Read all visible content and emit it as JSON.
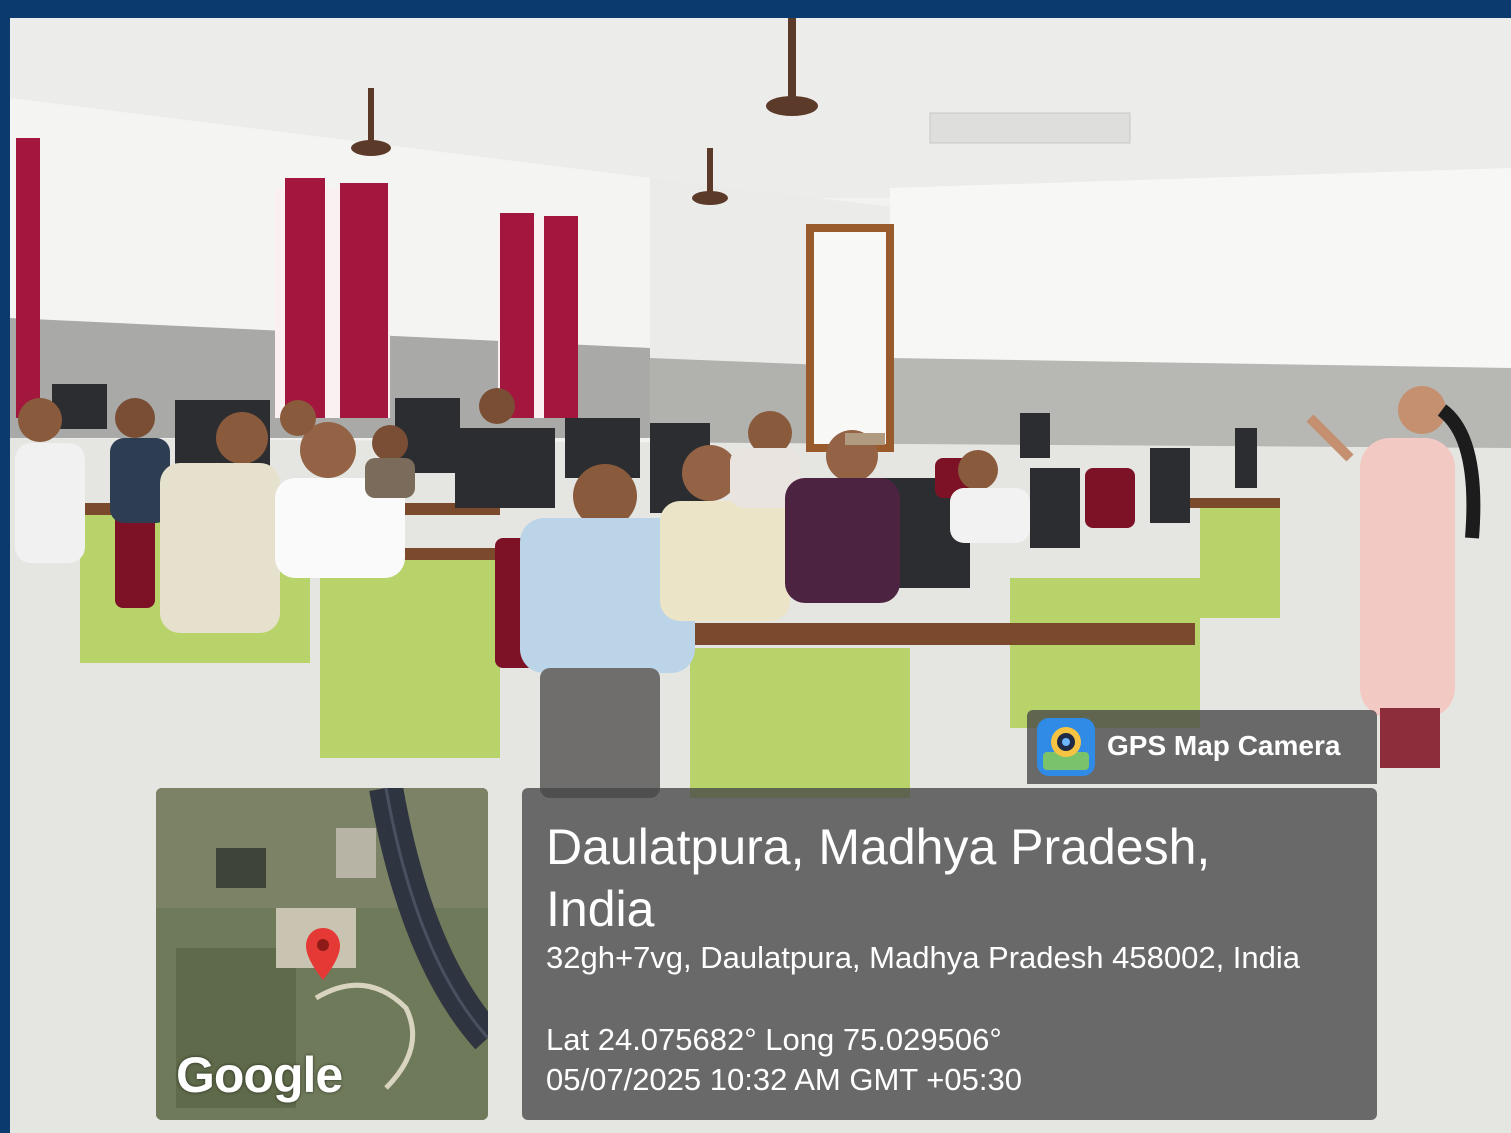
{
  "gps_badge": {
    "label": "GPS Map Camera",
    "icon": "location-camera-icon"
  },
  "map": {
    "provider_logo": "Google",
    "pin_icon": "map-pin-icon",
    "pin_color": "#e53935"
  },
  "location": {
    "title": "Daulatpura, Madhya Pradesh, India",
    "address": "32gh+7vg, Daulatpura, Madhya Pradesh 458002, India",
    "coordinates": "Lat 24.075682° Long 75.029506°",
    "datetime": "05/07/2025 10:32 AM GMT +05:30"
  },
  "colors": {
    "frame_border": "#0b3a6e",
    "overlay_panel": "#464646"
  }
}
